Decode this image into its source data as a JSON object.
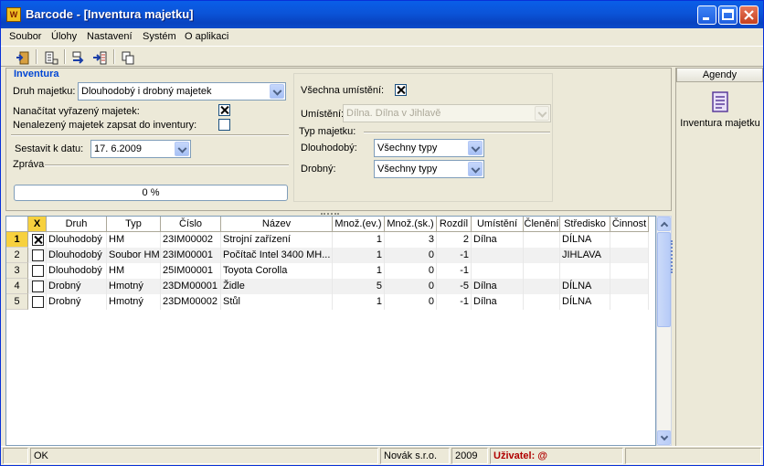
{
  "window": {
    "title": "Barcode - [Inventura majetku]",
    "app_icon_text": "W",
    "accent_color": "#0a58e0"
  },
  "menu": [
    {
      "label": "Soubor"
    },
    {
      "label": "Úlohy"
    },
    {
      "label": "Nastavení"
    },
    {
      "label": "Systém"
    },
    {
      "label": "O aplikaci"
    }
  ],
  "toolbar": {
    "icons": [
      "exit-door-icon",
      "document-list-icon",
      "transfer-arrows-icon",
      "copy-pages-icon"
    ]
  },
  "form": {
    "group_title": "Inventura",
    "druh_label": "Druh majetku:",
    "druh_value": "Dlouhodobý i drobný majetek",
    "nacitat_label": "Nanačítat vyřazený majetek:",
    "nacitat_checked": true,
    "nenalezeny_label": "Nenalezený majetek zapsat do inventury:",
    "nenalezeny_checked": false,
    "sestavit_label": "Sestavit k datu:",
    "sestavit_value": "17. 6.2009",
    "zprava_label": "Zpráva",
    "progress_text": "0 %",
    "progress_fraction": 0,
    "vsechna_label": "Všechna umístění:",
    "vsechna_checked": true,
    "umisteni_label": "Umístění:",
    "umisteni_value": "Dílna. Dílna v Jihlavě",
    "typ_group": "Typ majetku:",
    "dlouhodoby_label": "Dlouhodobý:",
    "dlouhodoby_value": "Všechny typy",
    "drobny_label": "Drobný:",
    "drobny_value": "Všechny typy"
  },
  "agendy": {
    "header": "Agendy",
    "item_label": "Inventura majetku"
  },
  "grid": {
    "headers": [
      "",
      "X",
      "Druh",
      "Typ",
      "Číslo",
      "Název",
      "Množ.(ev.)",
      "Množ.(sk.)",
      "Rozdíl",
      "Umístění",
      "Členění",
      "Středisko",
      "Činnost"
    ],
    "rows": [
      {
        "n": "1",
        "checked": true,
        "druh": "Dlouhodobý",
        "typ": "HM",
        "cislo": "23IM00002",
        "nazev": "Strojní zařízení",
        "ev": "1",
        "sk": "3",
        "rozdil": "2",
        "umisteni": "Dílna",
        "cleneni": "",
        "stredisko": "DÍLNA",
        "cinnost": ""
      },
      {
        "n": "2",
        "checked": false,
        "druh": "Dlouhodobý",
        "typ": "Soubor HM",
        "cislo": "23IM00001",
        "nazev": "Počítač Intel 3400 MH...",
        "ev": "1",
        "sk": "0",
        "rozdil": "-1",
        "umisteni": "",
        "cleneni": "",
        "stredisko": "JIHLAVA",
        "cinnost": ""
      },
      {
        "n": "3",
        "checked": false,
        "druh": "Dlouhodobý",
        "typ": "HM",
        "cislo": "25IM00001",
        "nazev": "Toyota Corolla",
        "ev": "1",
        "sk": "0",
        "rozdil": "-1",
        "umisteni": "",
        "cleneni": "",
        "stredisko": "",
        "cinnost": ""
      },
      {
        "n": "4",
        "checked": false,
        "druh": "Drobný",
        "typ": "Hmotný",
        "cislo": "23DM00001",
        "nazev": "Židle",
        "ev": "5",
        "sk": "0",
        "rozdil": "-5",
        "umisteni": "Dílna",
        "cleneni": "",
        "stredisko": "DÍLNA",
        "cinnost": ""
      },
      {
        "n": "5",
        "checked": false,
        "druh": "Drobný",
        "typ": "Hmotný",
        "cislo": "23DM00002",
        "nazev": "Stůl",
        "ev": "1",
        "sk": "0",
        "rozdil": "-1",
        "umisteni": "Dílna",
        "cleneni": "",
        "stredisko": "DÍLNA",
        "cinnost": ""
      }
    ]
  },
  "status": {
    "text": "OK",
    "company": "Novák s.r.o.",
    "year": "2009",
    "user_label": "Uživatel: @"
  }
}
